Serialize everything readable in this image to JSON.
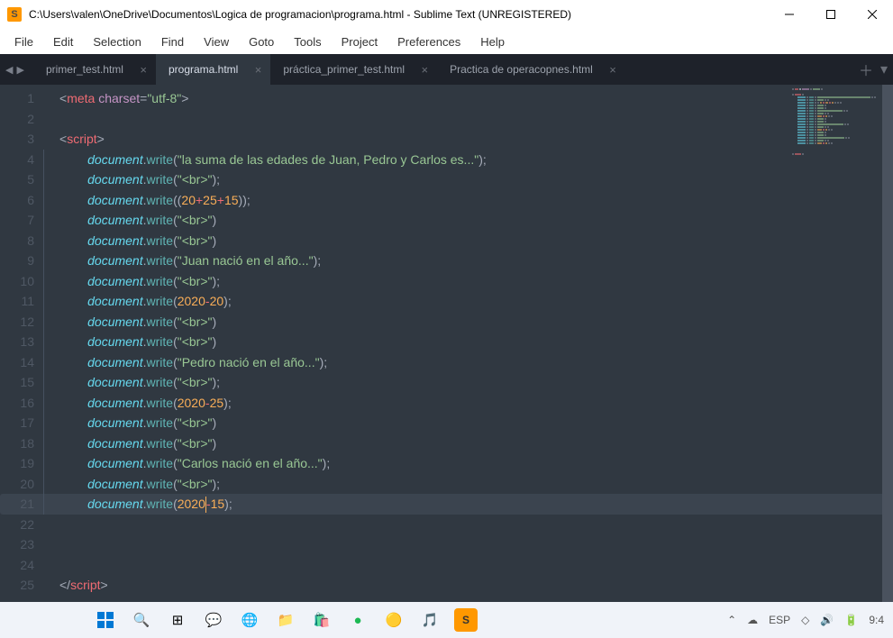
{
  "window": {
    "title": "C:\\Users\\valen\\OneDrive\\Documentos\\Logica de programacion\\programa.html - Sublime Text (UNREGISTERED)",
    "icon_letter": "S"
  },
  "menubar": [
    "File",
    "Edit",
    "Selection",
    "Find",
    "View",
    "Goto",
    "Tools",
    "Project",
    "Preferences",
    "Help"
  ],
  "tabs": [
    {
      "label": "primer_test.html",
      "active": false
    },
    {
      "label": "programa.html",
      "active": true
    },
    {
      "label": "práctica_primer_test.html",
      "active": false
    },
    {
      "label": "Practica de operacopnes.html",
      "active": false
    }
  ],
  "code": {
    "active_line": 21,
    "cursor_col_after_2020": true,
    "lines": [
      {
        "n": 1,
        "ind": 0,
        "tokens": [
          {
            "t": "pun",
            "v": "<"
          },
          {
            "t": "tag",
            "v": "meta"
          },
          {
            "t": "plain",
            "v": " "
          },
          {
            "t": "attr",
            "v": "charset"
          },
          {
            "t": "pun",
            "v": "="
          },
          {
            "t": "str",
            "v": "\"utf-8\""
          },
          {
            "t": "pun",
            "v": ">"
          }
        ]
      },
      {
        "n": 2,
        "ind": 0,
        "tokens": []
      },
      {
        "n": 3,
        "ind": 0,
        "tokens": [
          {
            "t": "pun",
            "v": "<"
          },
          {
            "t": "tag",
            "v": "script"
          },
          {
            "t": "pun",
            "v": ">"
          }
        ]
      },
      {
        "n": 4,
        "ind": 2,
        "tokens": [
          {
            "t": "obj",
            "v": "document"
          },
          {
            "t": "dot",
            "v": "."
          },
          {
            "t": "fn",
            "v": "write"
          },
          {
            "t": "pun",
            "v": "("
          },
          {
            "t": "str",
            "v": "\"la suma de las edades de Juan, Pedro y Carlos es...\""
          },
          {
            "t": "pun",
            "v": ")"
          },
          {
            "t": "pun",
            "v": ";"
          }
        ]
      },
      {
        "n": 5,
        "ind": 2,
        "tokens": [
          {
            "t": "obj",
            "v": "document"
          },
          {
            "t": "dot",
            "v": "."
          },
          {
            "t": "fn",
            "v": "write"
          },
          {
            "t": "pun",
            "v": "("
          },
          {
            "t": "str",
            "v": "\"<br>\""
          },
          {
            "t": "pun",
            "v": ")"
          },
          {
            "t": "pun",
            "v": ";"
          }
        ]
      },
      {
        "n": 6,
        "ind": 2,
        "tokens": [
          {
            "t": "obj",
            "v": "document"
          },
          {
            "t": "dot",
            "v": "."
          },
          {
            "t": "fn",
            "v": "write"
          },
          {
            "t": "pun",
            "v": "("
          },
          {
            "t": "pun",
            "v": "("
          },
          {
            "t": "num",
            "v": "20"
          },
          {
            "t": "op",
            "v": "+"
          },
          {
            "t": "num",
            "v": "25"
          },
          {
            "t": "op",
            "v": "+"
          },
          {
            "t": "num",
            "v": "15"
          },
          {
            "t": "pun",
            "v": ")"
          },
          {
            "t": "pun",
            "v": ")"
          },
          {
            "t": "pun",
            "v": ";"
          }
        ]
      },
      {
        "n": 7,
        "ind": 2,
        "tokens": [
          {
            "t": "obj",
            "v": "document"
          },
          {
            "t": "dot",
            "v": "."
          },
          {
            "t": "fn",
            "v": "write"
          },
          {
            "t": "pun",
            "v": "("
          },
          {
            "t": "str",
            "v": "\"<br>\""
          },
          {
            "t": "pun",
            "v": ")"
          }
        ]
      },
      {
        "n": 8,
        "ind": 2,
        "tokens": [
          {
            "t": "obj",
            "v": "document"
          },
          {
            "t": "dot",
            "v": "."
          },
          {
            "t": "fn",
            "v": "write"
          },
          {
            "t": "pun",
            "v": "("
          },
          {
            "t": "str",
            "v": "\"<br>\""
          },
          {
            "t": "pun",
            "v": ")"
          }
        ]
      },
      {
        "n": 9,
        "ind": 2,
        "tokens": [
          {
            "t": "obj",
            "v": "document"
          },
          {
            "t": "dot",
            "v": "."
          },
          {
            "t": "fn",
            "v": "write"
          },
          {
            "t": "pun",
            "v": "("
          },
          {
            "t": "str",
            "v": "\"Juan nació en el año...\""
          },
          {
            "t": "pun",
            "v": ")"
          },
          {
            "t": "pun",
            "v": ";"
          }
        ]
      },
      {
        "n": 10,
        "ind": 2,
        "tokens": [
          {
            "t": "obj",
            "v": "document"
          },
          {
            "t": "dot",
            "v": "."
          },
          {
            "t": "fn",
            "v": "write"
          },
          {
            "t": "pun",
            "v": "("
          },
          {
            "t": "str",
            "v": "\"<br>\""
          },
          {
            "t": "pun",
            "v": ")"
          },
          {
            "t": "pun",
            "v": ";"
          }
        ]
      },
      {
        "n": 11,
        "ind": 2,
        "tokens": [
          {
            "t": "obj",
            "v": "document"
          },
          {
            "t": "dot",
            "v": "."
          },
          {
            "t": "fn",
            "v": "write"
          },
          {
            "t": "pun",
            "v": "("
          },
          {
            "t": "num",
            "v": "2020"
          },
          {
            "t": "op",
            "v": "-"
          },
          {
            "t": "num",
            "v": "20"
          },
          {
            "t": "pun",
            "v": ")"
          },
          {
            "t": "pun",
            "v": ";"
          }
        ]
      },
      {
        "n": 12,
        "ind": 2,
        "tokens": [
          {
            "t": "obj",
            "v": "document"
          },
          {
            "t": "dot",
            "v": "."
          },
          {
            "t": "fn",
            "v": "write"
          },
          {
            "t": "pun",
            "v": "("
          },
          {
            "t": "str",
            "v": "\"<br>\""
          },
          {
            "t": "pun",
            "v": ")"
          }
        ]
      },
      {
        "n": 13,
        "ind": 2,
        "tokens": [
          {
            "t": "obj",
            "v": "document"
          },
          {
            "t": "dot",
            "v": "."
          },
          {
            "t": "fn",
            "v": "write"
          },
          {
            "t": "pun",
            "v": "("
          },
          {
            "t": "str",
            "v": "\"<br>\""
          },
          {
            "t": "pun",
            "v": ")"
          }
        ]
      },
      {
        "n": 14,
        "ind": 2,
        "tokens": [
          {
            "t": "obj",
            "v": "document"
          },
          {
            "t": "dot",
            "v": "."
          },
          {
            "t": "fn",
            "v": "write"
          },
          {
            "t": "pun",
            "v": "("
          },
          {
            "t": "str",
            "v": "\"Pedro nació en el año...\""
          },
          {
            "t": "pun",
            "v": ")"
          },
          {
            "t": "pun",
            "v": ";"
          }
        ]
      },
      {
        "n": 15,
        "ind": 2,
        "tokens": [
          {
            "t": "obj",
            "v": "document"
          },
          {
            "t": "dot",
            "v": "."
          },
          {
            "t": "fn",
            "v": "write"
          },
          {
            "t": "pun",
            "v": "("
          },
          {
            "t": "str",
            "v": "\"<br>\""
          },
          {
            "t": "pun",
            "v": ")"
          },
          {
            "t": "pun",
            "v": ";"
          }
        ]
      },
      {
        "n": 16,
        "ind": 2,
        "tokens": [
          {
            "t": "obj",
            "v": "document"
          },
          {
            "t": "dot",
            "v": "."
          },
          {
            "t": "fn",
            "v": "write"
          },
          {
            "t": "pun",
            "v": "("
          },
          {
            "t": "num",
            "v": "2020"
          },
          {
            "t": "op",
            "v": "-"
          },
          {
            "t": "num",
            "v": "25"
          },
          {
            "t": "pun",
            "v": ")"
          },
          {
            "t": "pun",
            "v": ";"
          }
        ]
      },
      {
        "n": 17,
        "ind": 2,
        "tokens": [
          {
            "t": "obj",
            "v": "document"
          },
          {
            "t": "dot",
            "v": "."
          },
          {
            "t": "fn",
            "v": "write"
          },
          {
            "t": "pun",
            "v": "("
          },
          {
            "t": "str",
            "v": "\"<br>\""
          },
          {
            "t": "pun",
            "v": ")"
          }
        ]
      },
      {
        "n": 18,
        "ind": 2,
        "tokens": [
          {
            "t": "obj",
            "v": "document"
          },
          {
            "t": "dot",
            "v": "."
          },
          {
            "t": "fn",
            "v": "write"
          },
          {
            "t": "pun",
            "v": "("
          },
          {
            "t": "str",
            "v": "\"<br>\""
          },
          {
            "t": "pun",
            "v": ")"
          }
        ]
      },
      {
        "n": 19,
        "ind": 2,
        "tokens": [
          {
            "t": "obj",
            "v": "document"
          },
          {
            "t": "dot",
            "v": "."
          },
          {
            "t": "fn",
            "v": "write"
          },
          {
            "t": "pun",
            "v": "("
          },
          {
            "t": "str",
            "v": "\"Carlos nació en el año...\""
          },
          {
            "t": "pun",
            "v": ")"
          },
          {
            "t": "pun",
            "v": ";"
          }
        ]
      },
      {
        "n": 20,
        "ind": 2,
        "tokens": [
          {
            "t": "obj",
            "v": "document"
          },
          {
            "t": "dot",
            "v": "."
          },
          {
            "t": "fn",
            "v": "write"
          },
          {
            "t": "pun",
            "v": "("
          },
          {
            "t": "str",
            "v": "\"<br>\""
          },
          {
            "t": "pun",
            "v": ")"
          },
          {
            "t": "pun",
            "v": ";"
          }
        ]
      },
      {
        "n": 21,
        "ind": 2,
        "tokens": [
          {
            "t": "obj",
            "v": "document"
          },
          {
            "t": "dot",
            "v": "."
          },
          {
            "t": "fn",
            "v": "write"
          },
          {
            "t": "pun",
            "v": "("
          },
          {
            "t": "num",
            "v": "2020"
          },
          {
            "t": "cursor",
            "v": ""
          },
          {
            "t": "op",
            "v": "-"
          },
          {
            "t": "num",
            "v": "15"
          },
          {
            "t": "pun",
            "v": ")"
          },
          {
            "t": "pun",
            "v": ";"
          }
        ]
      },
      {
        "n": 22,
        "ind": 0,
        "tokens": []
      },
      {
        "n": 23,
        "ind": 0,
        "tokens": []
      },
      {
        "n": 24,
        "ind": 0,
        "tokens": []
      },
      {
        "n": 25,
        "ind": 0,
        "tokens": [
          {
            "t": "pun",
            "v": "</"
          },
          {
            "t": "tag",
            "v": "script"
          },
          {
            "t": "pun",
            "v": ">"
          }
        ]
      }
    ]
  },
  "taskbar": {
    "lang": "ESP",
    "time": "9:4",
    "hidden_arrow": "⌃"
  }
}
